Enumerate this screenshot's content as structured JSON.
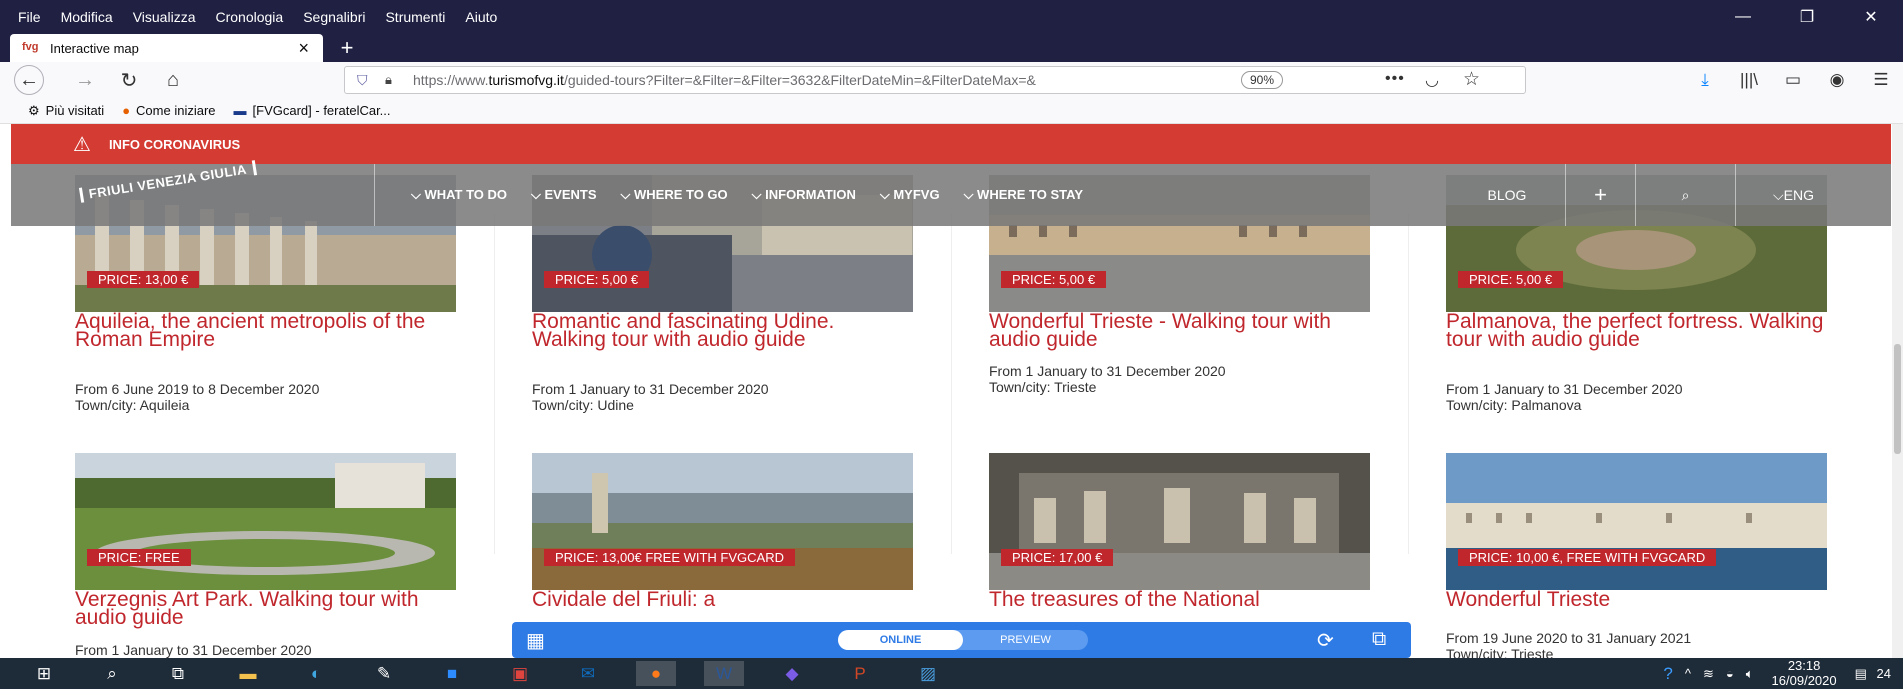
{
  "browser": {
    "menu": [
      "File",
      "Modifica",
      "Visualizza",
      "Cronologia",
      "Segnalibri",
      "Strumenti",
      "Aiuto"
    ],
    "tab_title": "Interactive map",
    "url_prefix": "https://www.",
    "url_domain": "turismofvg.it",
    "url_rest": "/guided-tours?Filter=&Filter=&Filter=3632&FilterDateMin=&FilterDateMax=&",
    "zoom": "90%",
    "bookmarks": [
      {
        "icon": "gear-icon",
        "label": "Più visitati"
      },
      {
        "icon": "firefox-icon",
        "label": "Come iniziare"
      },
      {
        "icon": "flag-icon",
        "label": "[FVGcard] - feratelCar..."
      }
    ]
  },
  "site": {
    "covid_label": "INFO CORONAVIRUS",
    "logo": "FRIULI VENEZIA GIULIA",
    "nav": [
      "WHAT TO DO",
      "EVENTS",
      "WHERE TO GO",
      "INFORMATION",
      "MYFVG",
      "WHERE TO STAY"
    ],
    "nav_right": {
      "blog": "BLOG",
      "plus": "+",
      "lang": "ENG"
    },
    "tours_row1": [
      {
        "price": "PRICE: 13,00 €",
        "title": "Aquileia, the ancient metropolis of the Roman Empire",
        "dates": "From 6 June 2019 to 8 December 2020",
        "town": "Town/city: Aquileia"
      },
      {
        "price": "PRICE: 5,00 €",
        "title": "Romantic and fascinating Udine. Walking tour with audio guide",
        "dates": "From 1 January to 31 December 2020",
        "town": "Town/city: Udine"
      },
      {
        "price": "PRICE: 5,00 €",
        "title": "Wonderful Trieste - Walking tour with audio guide",
        "dates": "From 1 January to 31 December 2020",
        "town": "Town/city: Trieste"
      },
      {
        "price": "PRICE: 5,00 €",
        "title": "Palmanova, the perfect fortress. Walking tour with audio guide",
        "dates": "From 1 January to 31 December 2020",
        "town": "Town/city: Palmanova"
      }
    ],
    "tours_row2": [
      {
        "price": "PRICE: FREE",
        "title": "Verzegnis Art Park. Walking tour with audio guide",
        "dates": "From 1 January to 31 December 2020"
      },
      {
        "price": "PRICE: 13,00€ FREE WITH FVGCARD",
        "title": "Cividale del Friuli: a"
      },
      {
        "price": "PRICE: 17,00 €",
        "title": "The treasures of the National"
      },
      {
        "price": "PRICE: 10,00 €, FREE WITH FVGCARD",
        "title": "Wonderful Trieste",
        "dates": "From 19 June 2020 to 31 January 2021",
        "town": "Town/city: Trieste"
      }
    ]
  },
  "preview_bar": {
    "online": "ONLINE",
    "preview": "PREVIEW"
  },
  "taskbar": {
    "time": "23:18",
    "date": "16/09/2020",
    "notifications": "24"
  },
  "colors": {
    "brand_red": "#c0272d",
    "covid_red": "#d43b32",
    "preview_blue": "#2f7be6",
    "taskbar": "#1e2b38"
  }
}
